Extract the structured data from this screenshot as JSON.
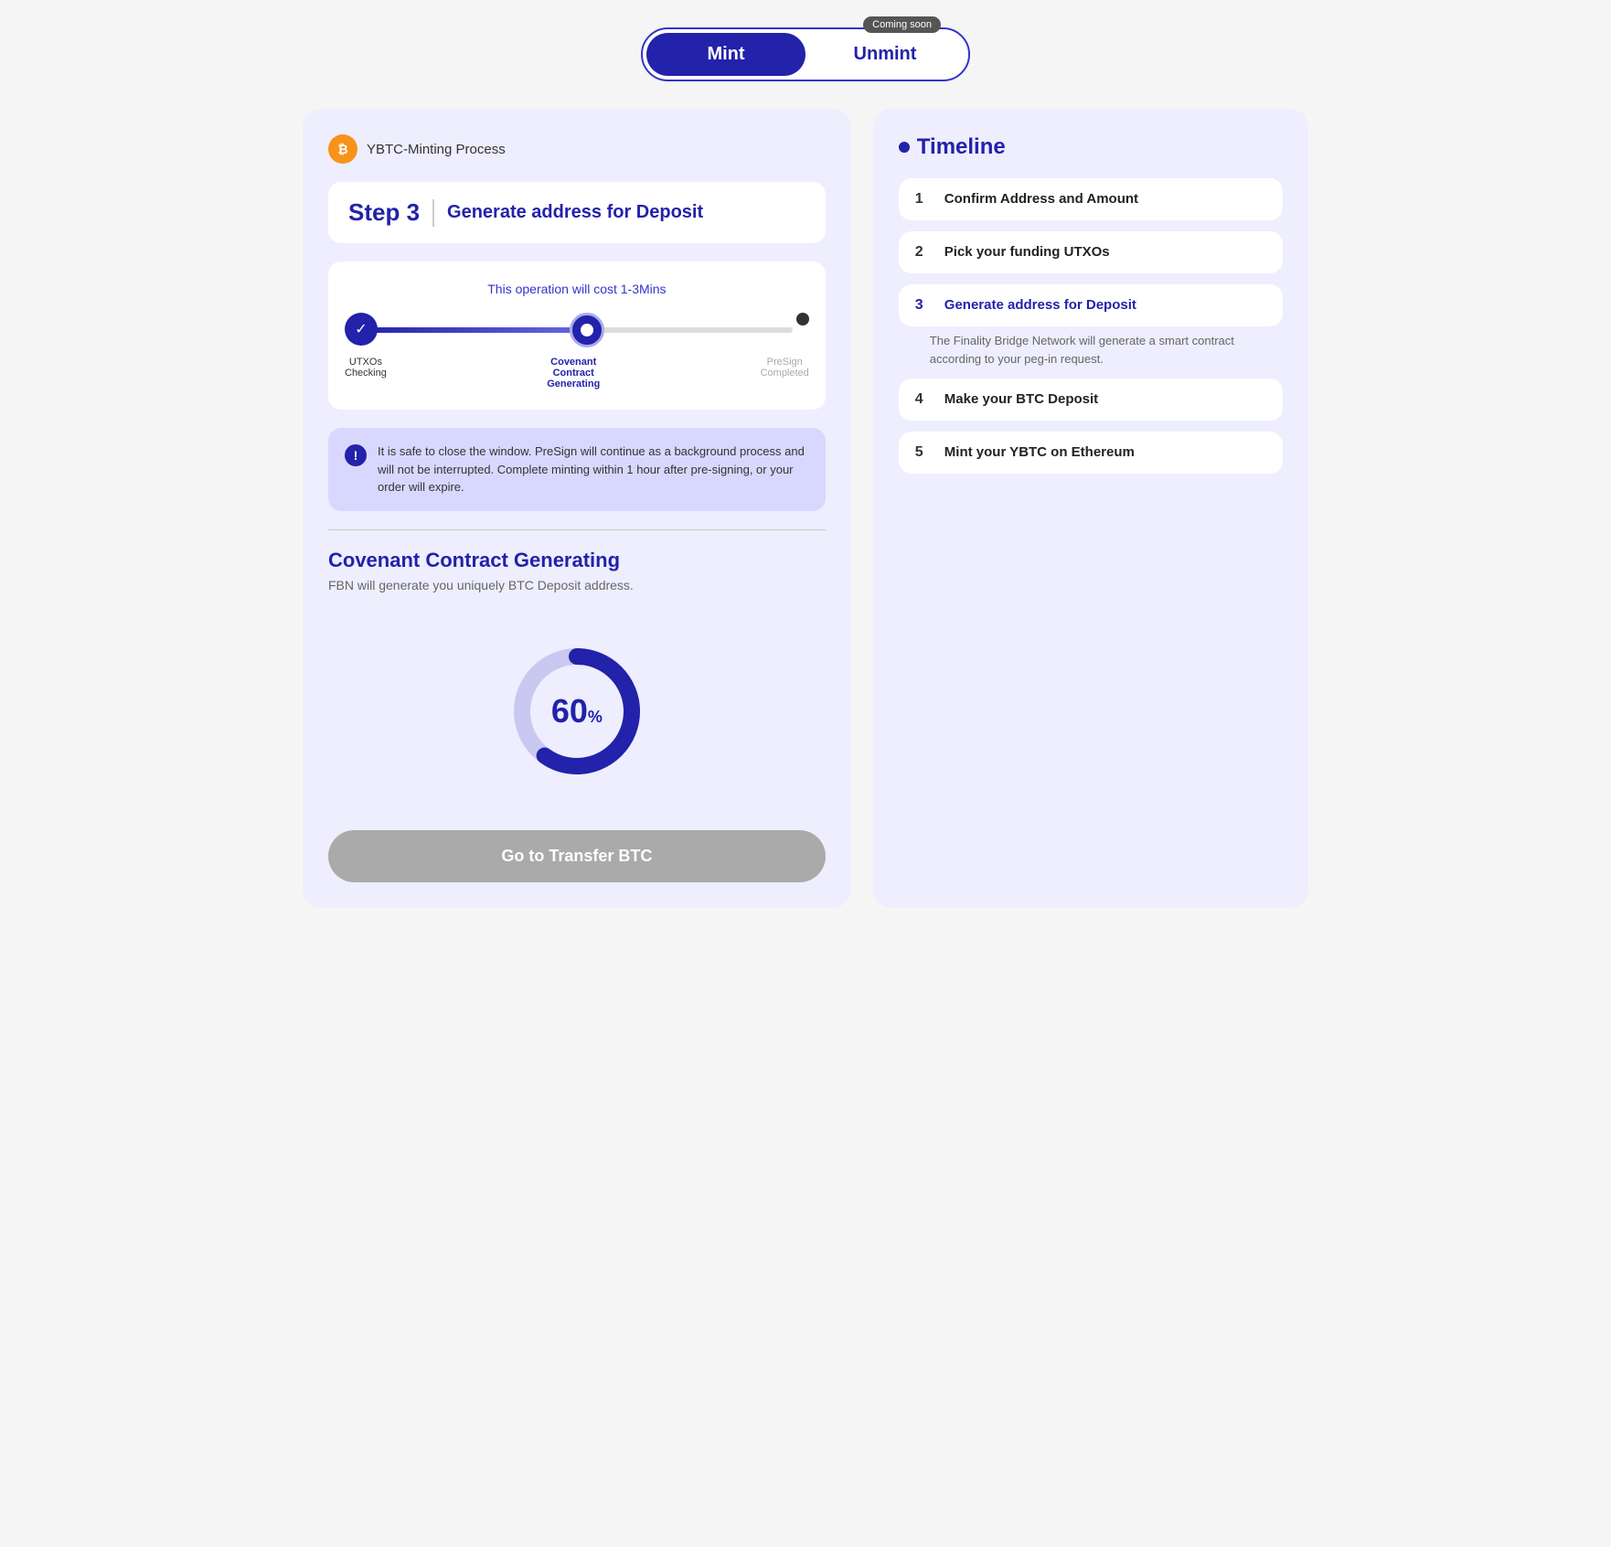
{
  "tabs": {
    "mint_label": "Mint",
    "unmint_label": "Unmint",
    "coming_soon": "Coming soon"
  },
  "left_panel": {
    "process_label": "YBTC-Minting Process",
    "step_number": "Step 3",
    "step_title": "Generate address for Deposit",
    "operation_cost": "This operation will cost 1-3Mins",
    "nodes": [
      {
        "id": "utxos",
        "label": "UTXOs\nChecking",
        "state": "completed"
      },
      {
        "id": "covenant",
        "label": "Covenant\nContract\nGenerating",
        "state": "active"
      },
      {
        "id": "presign",
        "label": "PreSign\nCompleted",
        "state": "pending"
      }
    ],
    "alert_text": "It is safe to close the window. PreSign will continue as a background process and will not be interrupted. Complete minting within 1 hour after pre-signing, or your order will expire.",
    "covenant_title": "Covenant Contract Generating",
    "covenant_desc": "FBN will generate you uniquely BTC Deposit address.",
    "progress_value": 60,
    "progress_label": "60",
    "transfer_btn_label": "Go to Transfer BTC"
  },
  "right_panel": {
    "timeline_title": "Timeline",
    "items": [
      {
        "num": "1",
        "label": "Confirm Address and Amount",
        "active": false,
        "desc": ""
      },
      {
        "num": "2",
        "label": "Pick your funding UTXOs",
        "active": false,
        "desc": ""
      },
      {
        "num": "3",
        "label": "Generate address for Deposit",
        "active": true,
        "desc": "The Finality Bridge Network will generate a smart contract according to your peg-in request."
      },
      {
        "num": "4",
        "label": "Make your BTC Deposit",
        "active": false,
        "desc": ""
      },
      {
        "num": "5",
        "label": "Mint your YBTC on Ethereum",
        "active": false,
        "desc": ""
      }
    ]
  }
}
